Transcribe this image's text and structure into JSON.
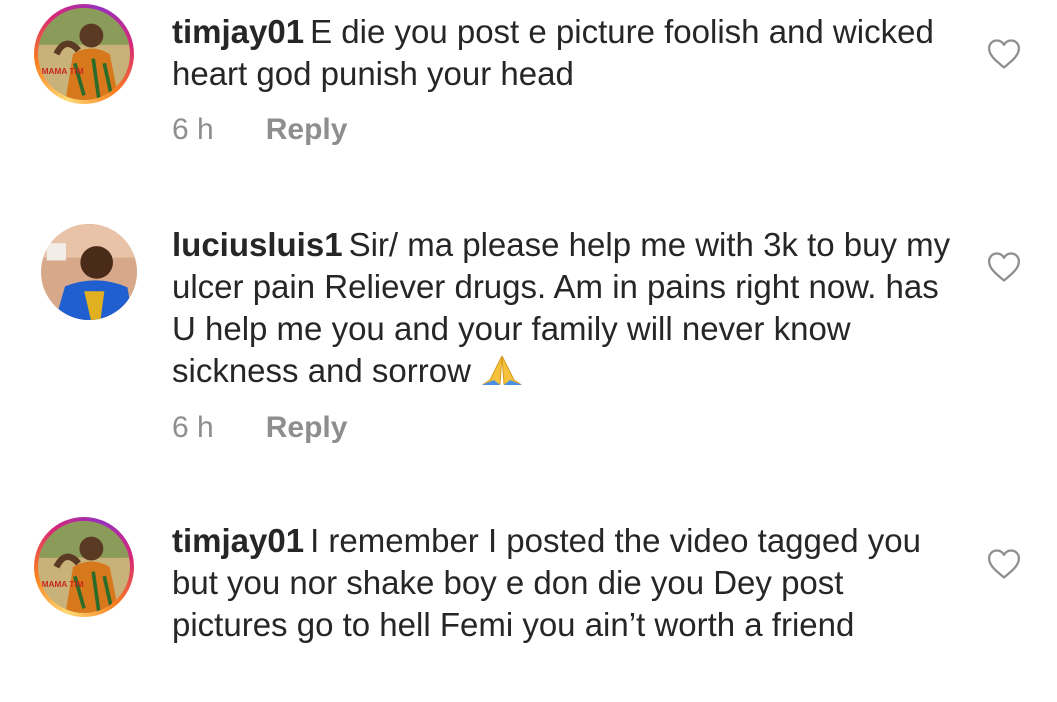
{
  "comments": [
    {
      "username": "timjay01",
      "text": "E die you post e picture foolish and wicked heart god punish your head",
      "time": "6 h",
      "reply_label": "Reply",
      "avatar_label": "MAMA TIM"
    },
    {
      "username": "luciusluis1",
      "text": "Sir/ ma please help me with 3k to buy my ulcer pain Reliever drugs. Am in pains right now. has U help me you and your family will never know sickness and sorrow",
      "time": "6 h",
      "reply_label": "Reply",
      "emoji": "folded-hands-emoji"
    },
    {
      "username": "timjay01",
      "text": "I remember I posted the video tagged you but you nor shake boy e don die you Dey post pictures go to hell Femi you ain’t worth a friend",
      "avatar_label": "MAMA TIM"
    }
  ],
  "icons": {
    "like": "heart-outline-icon"
  },
  "colors": {
    "text": "#262626",
    "meta": "#8e8e8e",
    "story_ring": [
      "#feda75",
      "#fa7e1e",
      "#d62976",
      "#962fbf"
    ]
  }
}
